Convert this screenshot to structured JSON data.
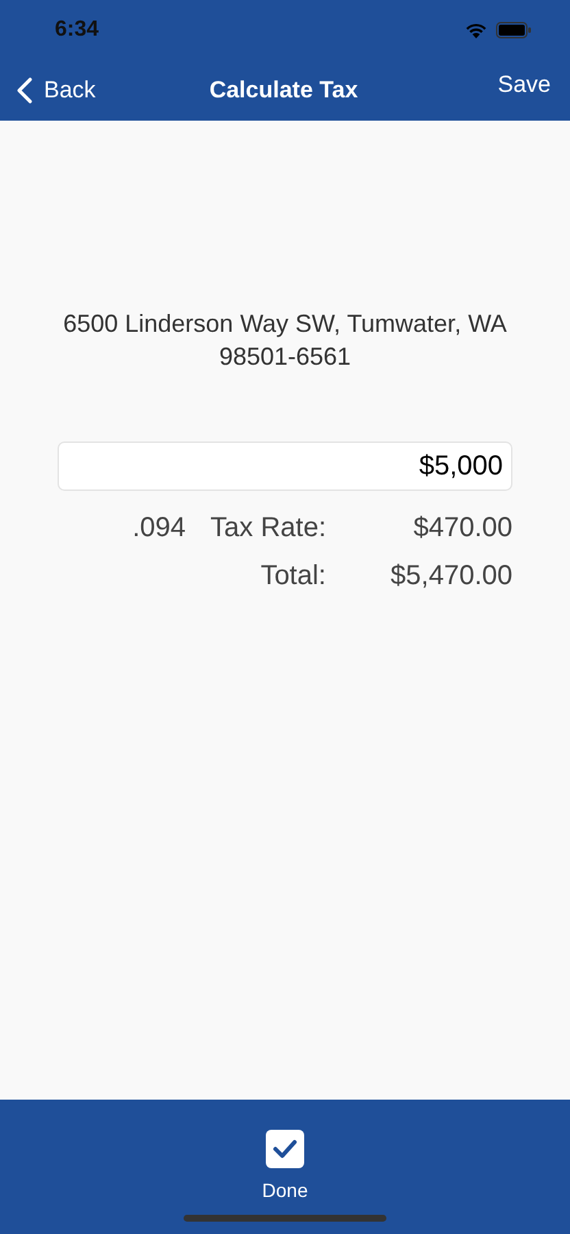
{
  "status_bar": {
    "time": "6:34"
  },
  "nav": {
    "back": "Back",
    "title": "Calculate Tax",
    "action": "Save"
  },
  "address": "6500 Linderson Way SW, Tumwater, WA 98501-6561",
  "amount_field": {
    "value": "$5,000"
  },
  "rows": [
    {
      "rate": ".094",
      "label": "Tax Rate:",
      "value": "$470.00"
    },
    {
      "label": "Total:",
      "value": "$5,470.00"
    }
  ],
  "bottom_bar": {
    "done": {
      "label": "Done",
      "checked": true
    }
  }
}
